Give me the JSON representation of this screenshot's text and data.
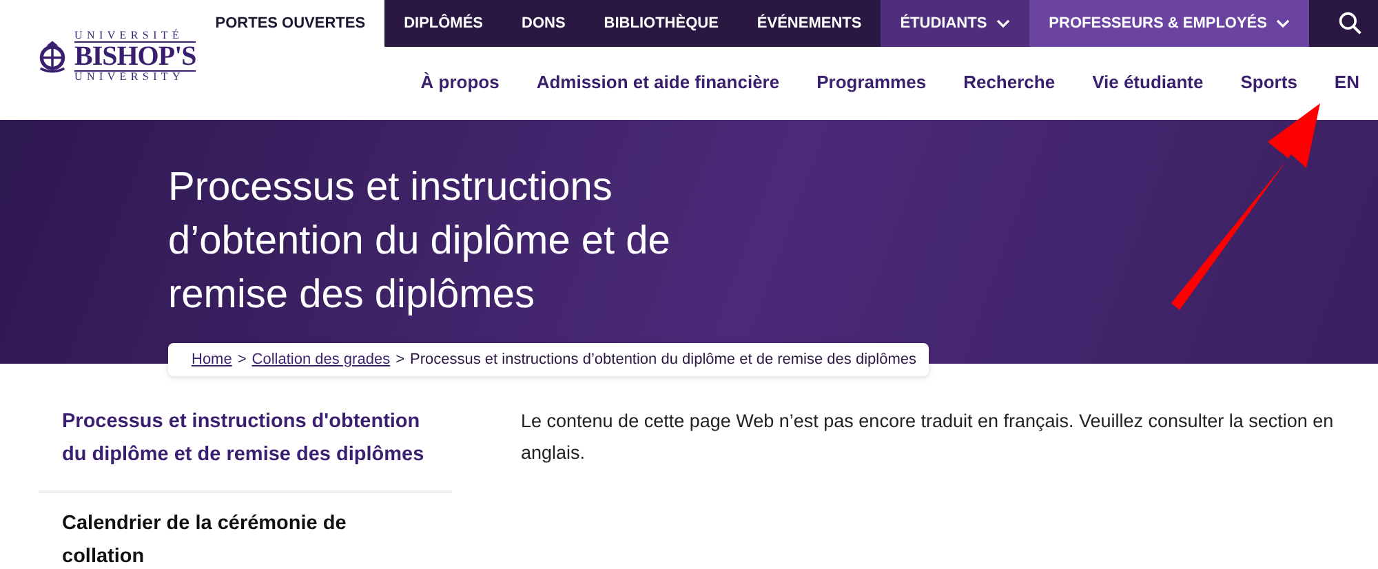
{
  "logo": {
    "line_1": "UNIVERSITÉ",
    "line_2": "BISHOP'S",
    "line_3": "UNIVERSITY"
  },
  "top_nav": [
    {
      "label": "PORTES OUVERTES",
      "kind": "light",
      "has_menu": false
    },
    {
      "label": "DIPLÔMÉS",
      "kind": "dark",
      "has_menu": false
    },
    {
      "label": "DONS",
      "kind": "dark",
      "has_menu": false
    },
    {
      "label": "BIBLIOTHÈQUE",
      "kind": "dark",
      "has_menu": false
    },
    {
      "label": "ÉVÉNEMENTS",
      "kind": "dark",
      "has_menu": false
    },
    {
      "label": "ÉTUDIANTS",
      "kind": "accent",
      "has_menu": true
    },
    {
      "label": "PROFESSEURS & EMPLOYÉS",
      "kind": "accent2",
      "has_menu": true
    }
  ],
  "main_nav": [
    "À propos",
    "Admission et aide financière",
    "Programmes",
    "Recherche",
    "Vie étudiante",
    "Sports",
    "EN"
  ],
  "hero": {
    "title": "Processus et instructions d’obtention du diplôme et de remise des diplômes"
  },
  "breadcrumb": [
    {
      "label": "Home",
      "link": true
    },
    {
      "label": ">",
      "link": false
    },
    {
      "label": "Collation des grades",
      "link": true
    },
    {
      "label": ">",
      "link": false
    },
    {
      "label": "Processus et instructions d’obtention du diplôme et de remise des diplômes",
      "link": false
    }
  ],
  "sidebar": [
    {
      "label": "Processus et instructions d'obtention du diplôme et de remise des diplômes",
      "selected": true
    },
    {
      "label": "Calendrier de la cérémonie de collation",
      "selected": false
    }
  ],
  "content": "Le contenu de cette page Web n’est pas encore traduit en français. Veuillez consulter la section en anglais."
}
